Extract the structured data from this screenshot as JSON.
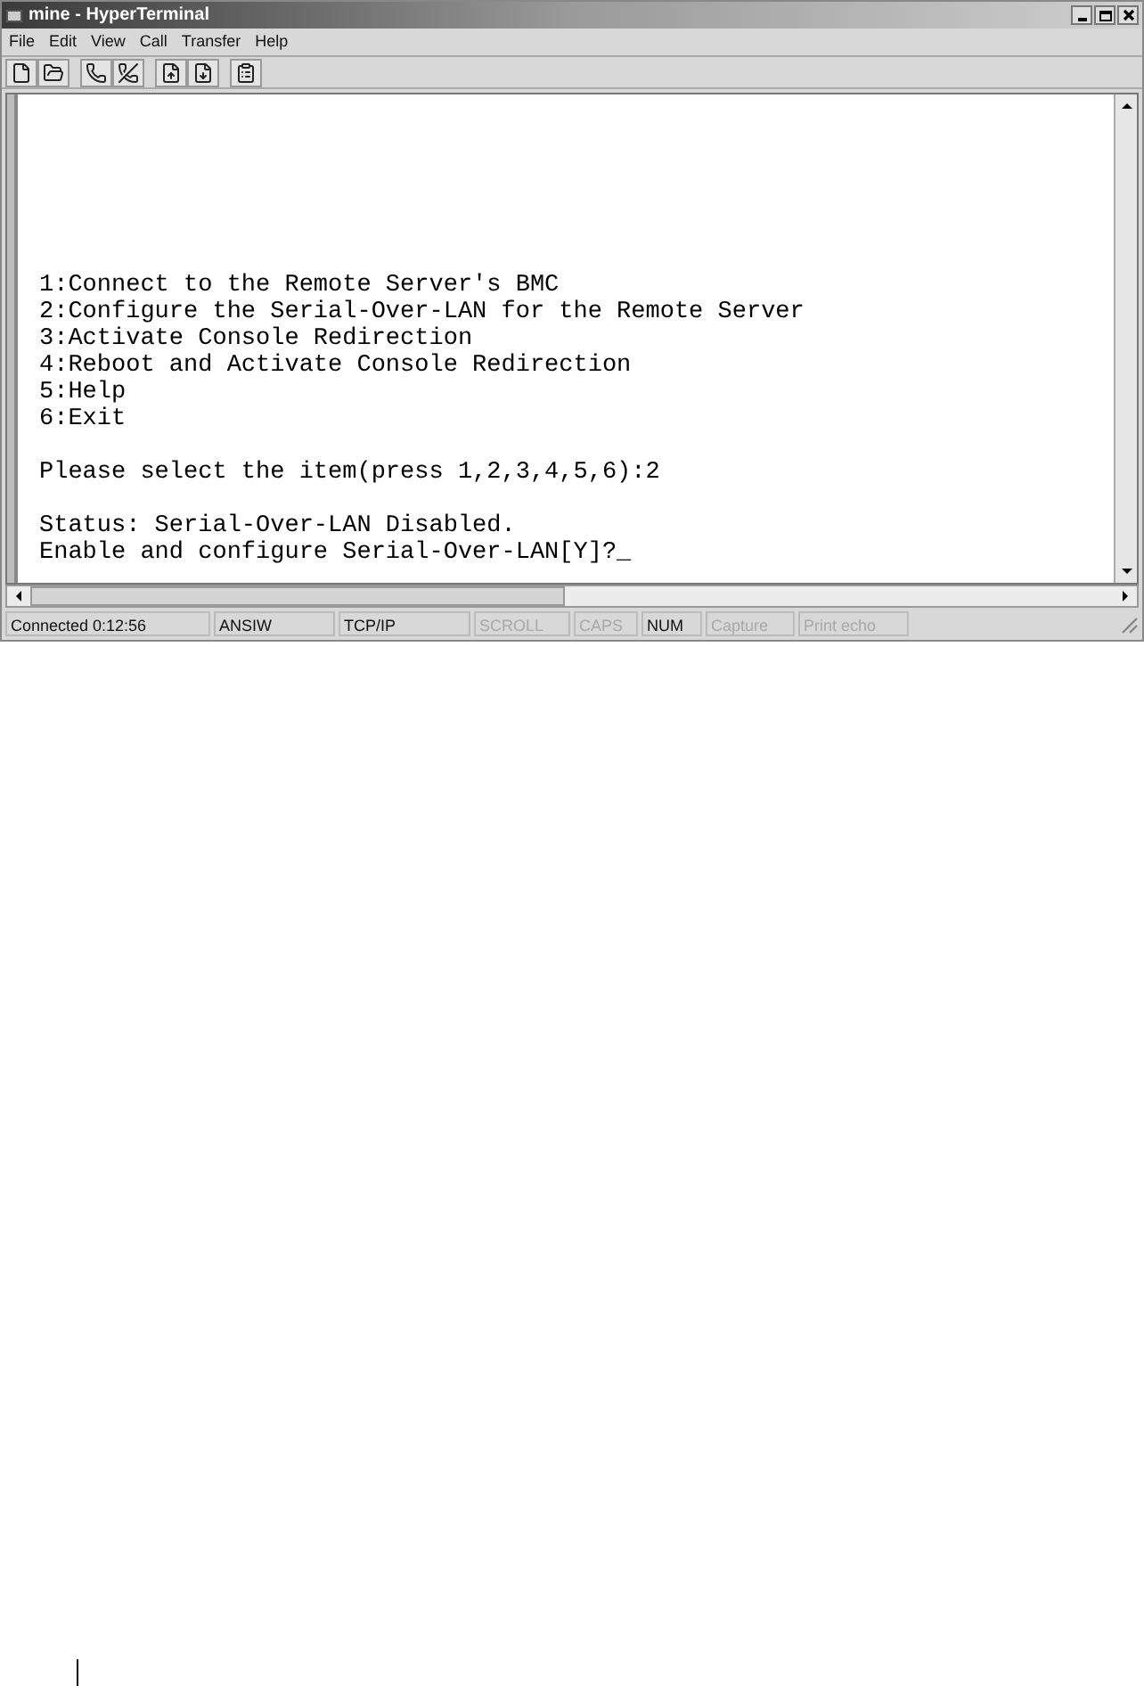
{
  "window": {
    "title": "mine - HyperTerminal"
  },
  "menu": [
    "File",
    "Edit",
    "View",
    "Call",
    "Transfer",
    "Help"
  ],
  "terminal": {
    "blocks": [
      [
        "1:Connect to the Remote Server's BMC",
        "2:Configure the Serial-Over-LAN for the Remote Server",
        "3:Activate Console Redirection",
        "4:Reboot and Activate Console Redirection",
        "5:Help",
        "6:Exit"
      ],
      [
        "Please select the item(press 1,2,3,4,5,6):2"
      ],
      [
        "Status: Serial-Over-LAN Disabled.",
        "Enable and configure Serial-Over-LAN[Y]?_"
      ]
    ]
  },
  "status_bar": [
    {
      "text": "Connected 0:12:56",
      "active": true
    },
    {
      "text": "ANSIW",
      "active": true
    },
    {
      "text": "TCP/IP",
      "active": true
    },
    {
      "text": "SCROLL",
      "active": false
    },
    {
      "text": "CAPS",
      "active": false
    },
    {
      "text": "NUM",
      "active": true
    },
    {
      "text": "Capture",
      "active": false
    },
    {
      "text": "Print echo",
      "active": false
    }
  ]
}
